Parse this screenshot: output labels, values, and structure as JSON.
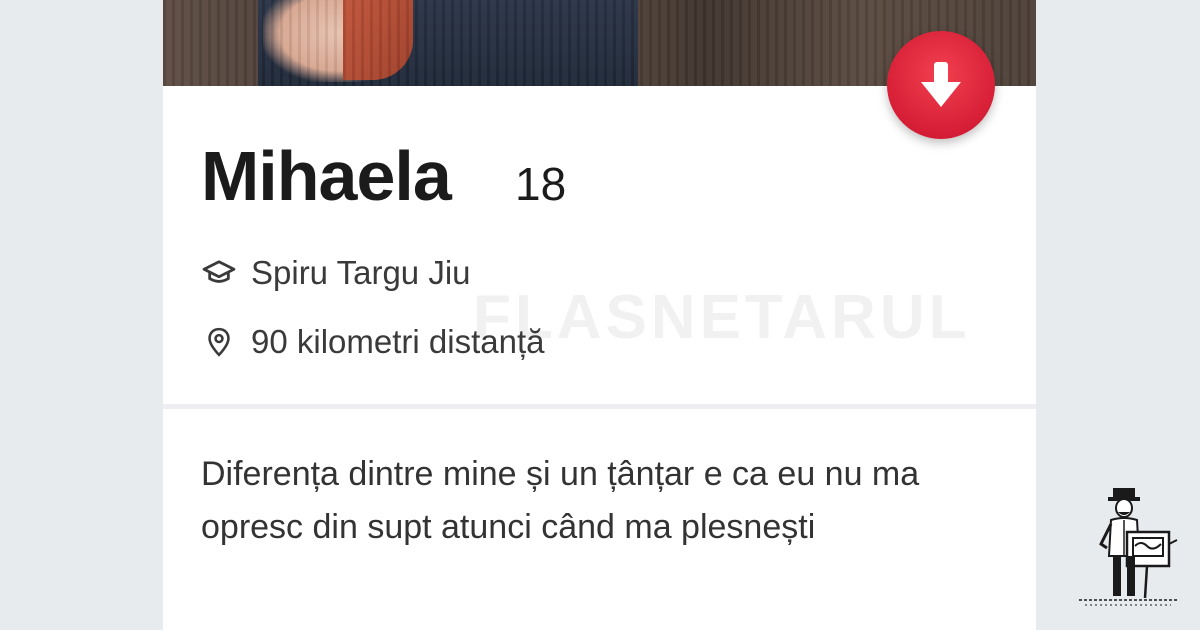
{
  "profile": {
    "name": "Mihaela",
    "age": "18",
    "school": "Spiru Targu Jiu",
    "distance": "90 kilometri distanță",
    "bio": "Diferența dintre mine și un țânțar e ca eu nu ma opresc din supt atunci când ma plesnești"
  },
  "watermark": "FLASNETARUL",
  "icons": {
    "school": "graduation-cap-icon",
    "distance": "location-pin-icon",
    "action": "arrow-down-icon",
    "logo": "organ-grinder-logo"
  },
  "colors": {
    "background": "#e8ebee",
    "card": "#ffffff",
    "accent": "#e3263e",
    "text": "#1b1b1b"
  }
}
